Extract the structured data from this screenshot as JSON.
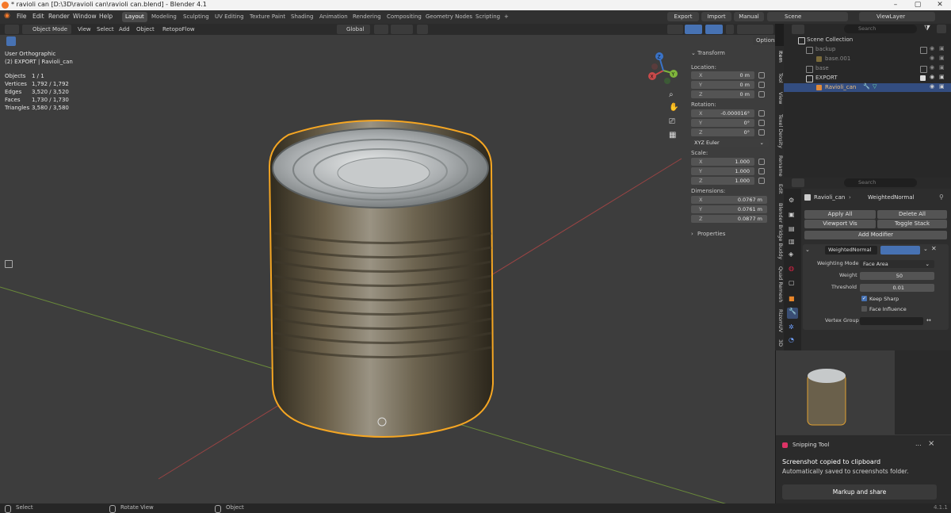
{
  "window": {
    "title": "* ravioli can [D:\\3D\\ravioli can\\ravioli can.blend] - Blender 4.1"
  },
  "menu": [
    "File",
    "Edit",
    "Render",
    "Window",
    "Help"
  ],
  "workspaces": [
    "Layout",
    "Modeling",
    "Sculpting",
    "UV Editing",
    "Texture Paint",
    "Shading",
    "Animation",
    "Rendering",
    "Compositing",
    "Geometry Nodes",
    "Scripting",
    "+"
  ],
  "topbar": {
    "export": "Export",
    "import": "Import",
    "manual": "Manual",
    "scene": "Scene",
    "viewlayer": "ViewLayer"
  },
  "header": {
    "mode": "Object Mode",
    "view": "View",
    "select": "Select",
    "add": "Add",
    "object": "Object",
    "retopoflow": "RetopoFlow",
    "orientation": "Global",
    "options": "Options"
  },
  "viewport": {
    "view_name": "User Orthographic",
    "collection_line": "(2) EXPORT | Ravioli_can",
    "stats": [
      {
        "label": "Objects",
        "value": "1 / 1"
      },
      {
        "label": "Vertices",
        "value": "1,792 / 1,792"
      },
      {
        "label": "Edges",
        "value": "3,520 / 3,520"
      },
      {
        "label": "Faces",
        "value": "1,730 / 1,730"
      },
      {
        "label": "Triangles",
        "value": "3,580 / 3,580"
      }
    ],
    "gizmo": {
      "x": "X",
      "y": "Y",
      "z": "Z"
    }
  },
  "npanel": {
    "title": "Transform",
    "location_label": "Location:",
    "location": [
      {
        "axis": "X",
        "value": "0 m"
      },
      {
        "axis": "Y",
        "value": "0 m"
      },
      {
        "axis": "Z",
        "value": "0 m"
      }
    ],
    "rotation_label": "Rotation:",
    "rotation": [
      {
        "axis": "X",
        "value": "-0.000016°"
      },
      {
        "axis": "Y",
        "value": "0°"
      },
      {
        "axis": "Z",
        "value": "0°"
      }
    ],
    "rotation_mode": "XYZ Euler",
    "scale_label": "Scale:",
    "scale": [
      {
        "axis": "X",
        "value": "1.000"
      },
      {
        "axis": "Y",
        "value": "1.000"
      },
      {
        "axis": "Z",
        "value": "1.000"
      }
    ],
    "dimensions_label": "Dimensions:",
    "dimensions": [
      {
        "axis": "X",
        "value": "0.0767 m"
      },
      {
        "axis": "Y",
        "value": "0.0761 m"
      },
      {
        "axis": "Z",
        "value": "0.0877 m"
      }
    ],
    "properties": "Properties"
  },
  "side_tabs": [
    "Item",
    "Tool",
    "View",
    "Texel Density",
    "Rename",
    "Edit",
    "Blender Bridge Buddy",
    "Quad Remesh",
    "RizomUV",
    "3D"
  ],
  "outliner": {
    "search_placeholder": "Search",
    "rows": [
      {
        "name": "Scene Collection"
      },
      {
        "name": "backup"
      },
      {
        "name": "base.001"
      },
      {
        "name": "base"
      },
      {
        "name": "EXPORT"
      },
      {
        "name": "Ravioli_can"
      }
    ]
  },
  "properties": {
    "search_placeholder": "Search",
    "breadcrumb_object": "Ravioli_can",
    "breadcrumb_modifier": "WeightedNormal",
    "apply_all": "Apply All",
    "delete_all": "Delete All",
    "viewport_vis": "Viewport Vis",
    "toggle_stack": "Toggle Stack",
    "add_modifier": "Add Modifier",
    "modifier_name": "WeightedNormal",
    "weighting_mode_label": "Weighting Mode",
    "weighting_mode": "Face Area",
    "weight_label": "Weight",
    "weight": "50",
    "threshold_label": "Threshold",
    "threshold": "0.01",
    "keep_sharp": "Keep Sharp",
    "face_influence": "Face Influence",
    "vertex_group_label": "Vertex Group"
  },
  "snipping": {
    "app": "Snipping Tool",
    "line1": "Screenshot copied to clipboard",
    "line2": "Automatically saved to screenshots folder.",
    "action": "Markup and share",
    "more": "...",
    "close": "×"
  },
  "status": {
    "select": "Select",
    "rotate": "Rotate View",
    "object": "Object",
    "version": "4.1.1"
  },
  "colors": {
    "selection_outline": "#f5a623",
    "accent_blue": "#4772b3",
    "x_axis": "#c84a4a",
    "y_axis": "#7fb43c",
    "z_axis": "#3a73c8"
  }
}
